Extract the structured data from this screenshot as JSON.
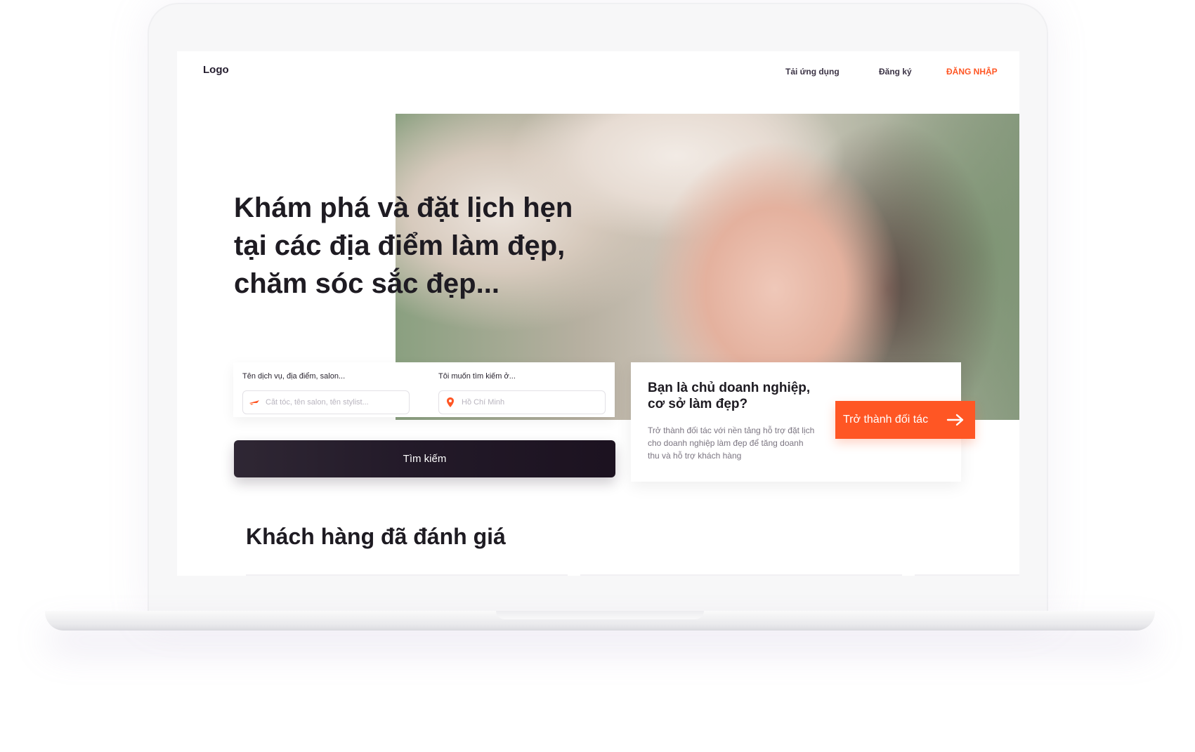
{
  "header": {
    "logo": "Logo",
    "nav": {
      "download_app": "Tải ứng dụng",
      "register": "Đăng ký",
      "login": "ĐĂNG NHẬP"
    }
  },
  "hero": {
    "title": "Khám phá và đặt lịch hẹn tại các địa điểm làm đẹp, chăm sóc sắc đẹp..."
  },
  "search": {
    "service_label": "Tên dịch vụ, địa điểm, salon...",
    "service_placeholder": "Cắt tóc, tên salon, tên stylist...",
    "location_label": "Tôi muốn tìm kiếm ở...",
    "location_placeholder": "Hồ Chí Minh",
    "button": "Tìm kiếm"
  },
  "partner": {
    "heading": "Bạn là chủ doanh nghiệp, cơ sở làm đẹp?",
    "description": "Trở thành đối tác với nền tảng hỗ trợ đặt lịch cho doanh nghiệp làm đẹp để tăng doanh thu và hỗ trợ khách hàng",
    "button": "Trở thành đối tác"
  },
  "reviews": {
    "title": "Khách hàng đã đánh giá"
  },
  "colors": {
    "accent": "#ff5624",
    "dark": "#1e1b22"
  },
  "icons": {
    "service_field": "scissors-icon",
    "location_field": "location-pin-icon",
    "partner_button": "arrow-right-icon"
  }
}
